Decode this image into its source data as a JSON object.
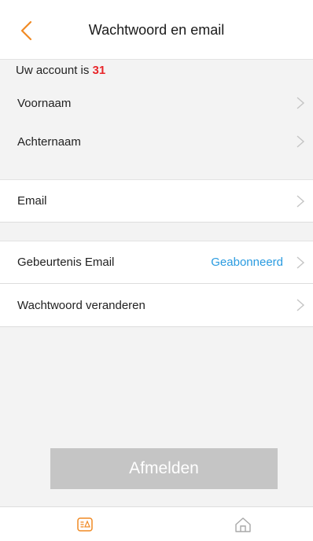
{
  "header": {
    "title": "Wachtwoord en email",
    "back_icon": "chevron-left-icon",
    "accent_color": "#f08a24"
  },
  "account": {
    "prefix": "Uw account is",
    "number": "31"
  },
  "rows": [
    {
      "label": "Voornaam",
      "value": ""
    },
    {
      "label": "Achternaam",
      "value": ""
    },
    {
      "label": "Email",
      "value": ""
    },
    {
      "label": "Gebeurtenis Email",
      "value": "Geabonneerd"
    },
    {
      "label": "Wachtwoord veranderen",
      "value": ""
    }
  ],
  "logout": {
    "label": "Afmelden"
  },
  "nav": {
    "items": [
      {
        "icon": "device-list-icon",
        "active": true
      },
      {
        "icon": "home-icon",
        "active": false
      }
    ]
  },
  "colors": {
    "value_blue": "#2a9be0",
    "account_red": "#e8262a",
    "button_gray": "#c5c5c5"
  }
}
